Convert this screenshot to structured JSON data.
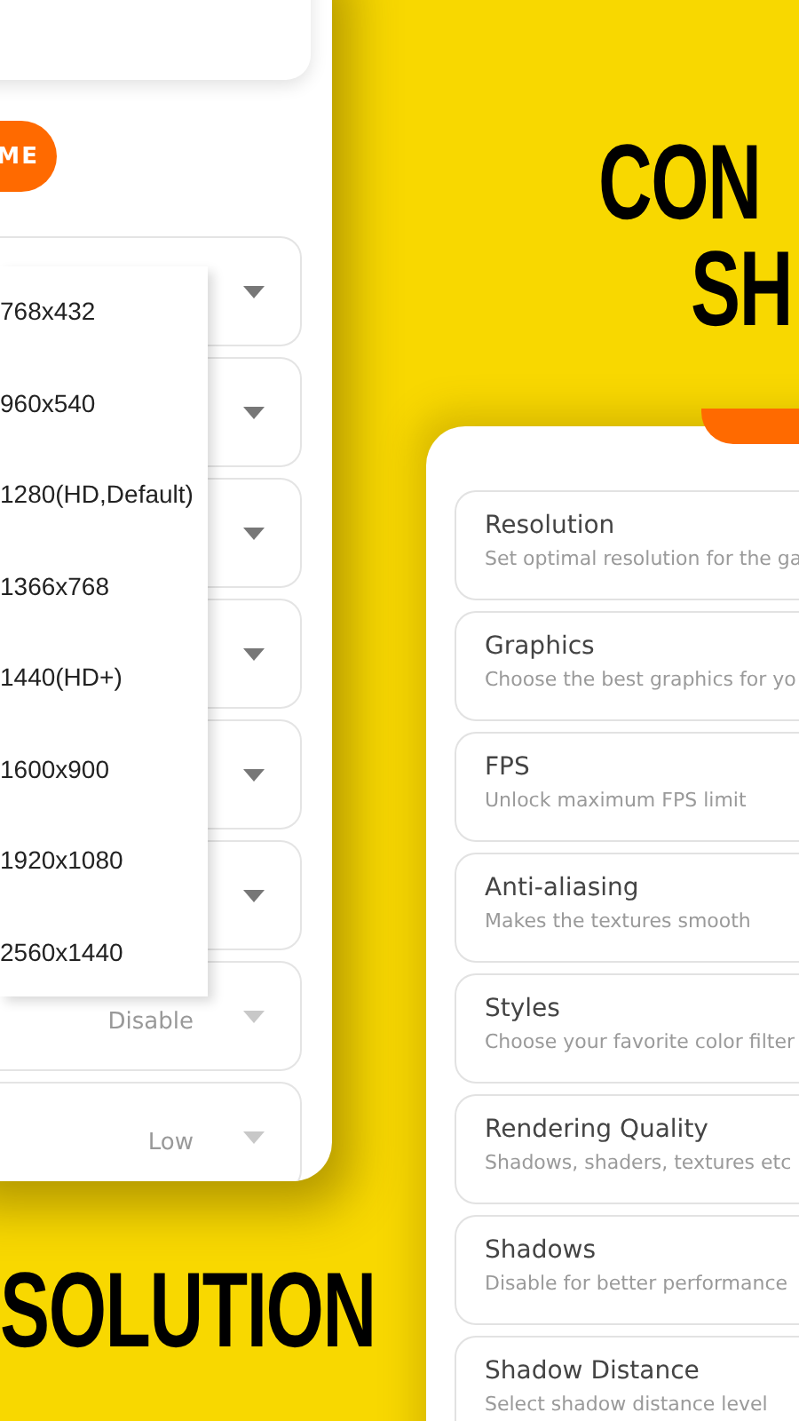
{
  "headline": [
    "CON",
    "SH"
  ],
  "left_screen": {
    "action_button": {
      "label": "ME"
    },
    "selects": [
      {
        "disabled": false
      },
      {
        "disabled": false
      },
      {
        "disabled": false
      },
      {
        "disabled": false
      },
      {
        "disabled": false
      },
      {
        "disabled": false
      },
      {
        "disabled": true,
        "value": "Disable"
      },
      {
        "disabled": true,
        "value": "Low"
      }
    ],
    "dropdown_options": [
      "768x432",
      "960x540",
      "1280(HD,Default)",
      "1366x768",
      "1440(HD+)",
      "1600x900",
      "1920x1080",
      "2560x1440"
    ]
  },
  "caption": "SOLUTION",
  "right_screen": {
    "settings": [
      {
        "title": "Resolution",
        "description": "Set optimal resolution for the ga"
      },
      {
        "title": "Graphics",
        "description": "Choose the best graphics for yo"
      },
      {
        "title": "FPS",
        "description": "Unlock maximum FPS limit"
      },
      {
        "title": "Anti-aliasing",
        "description": "Makes the textures smooth"
      },
      {
        "title": "Styles",
        "description": "Choose your favorite color filter"
      },
      {
        "title": "Rendering Quality",
        "description": "Shadows, shaders, textures etc"
      },
      {
        "title": "Shadows",
        "description": "Disable for better performance"
      },
      {
        "title": "Shadow Distance",
        "description": "Select shadow distance level"
      }
    ]
  }
}
